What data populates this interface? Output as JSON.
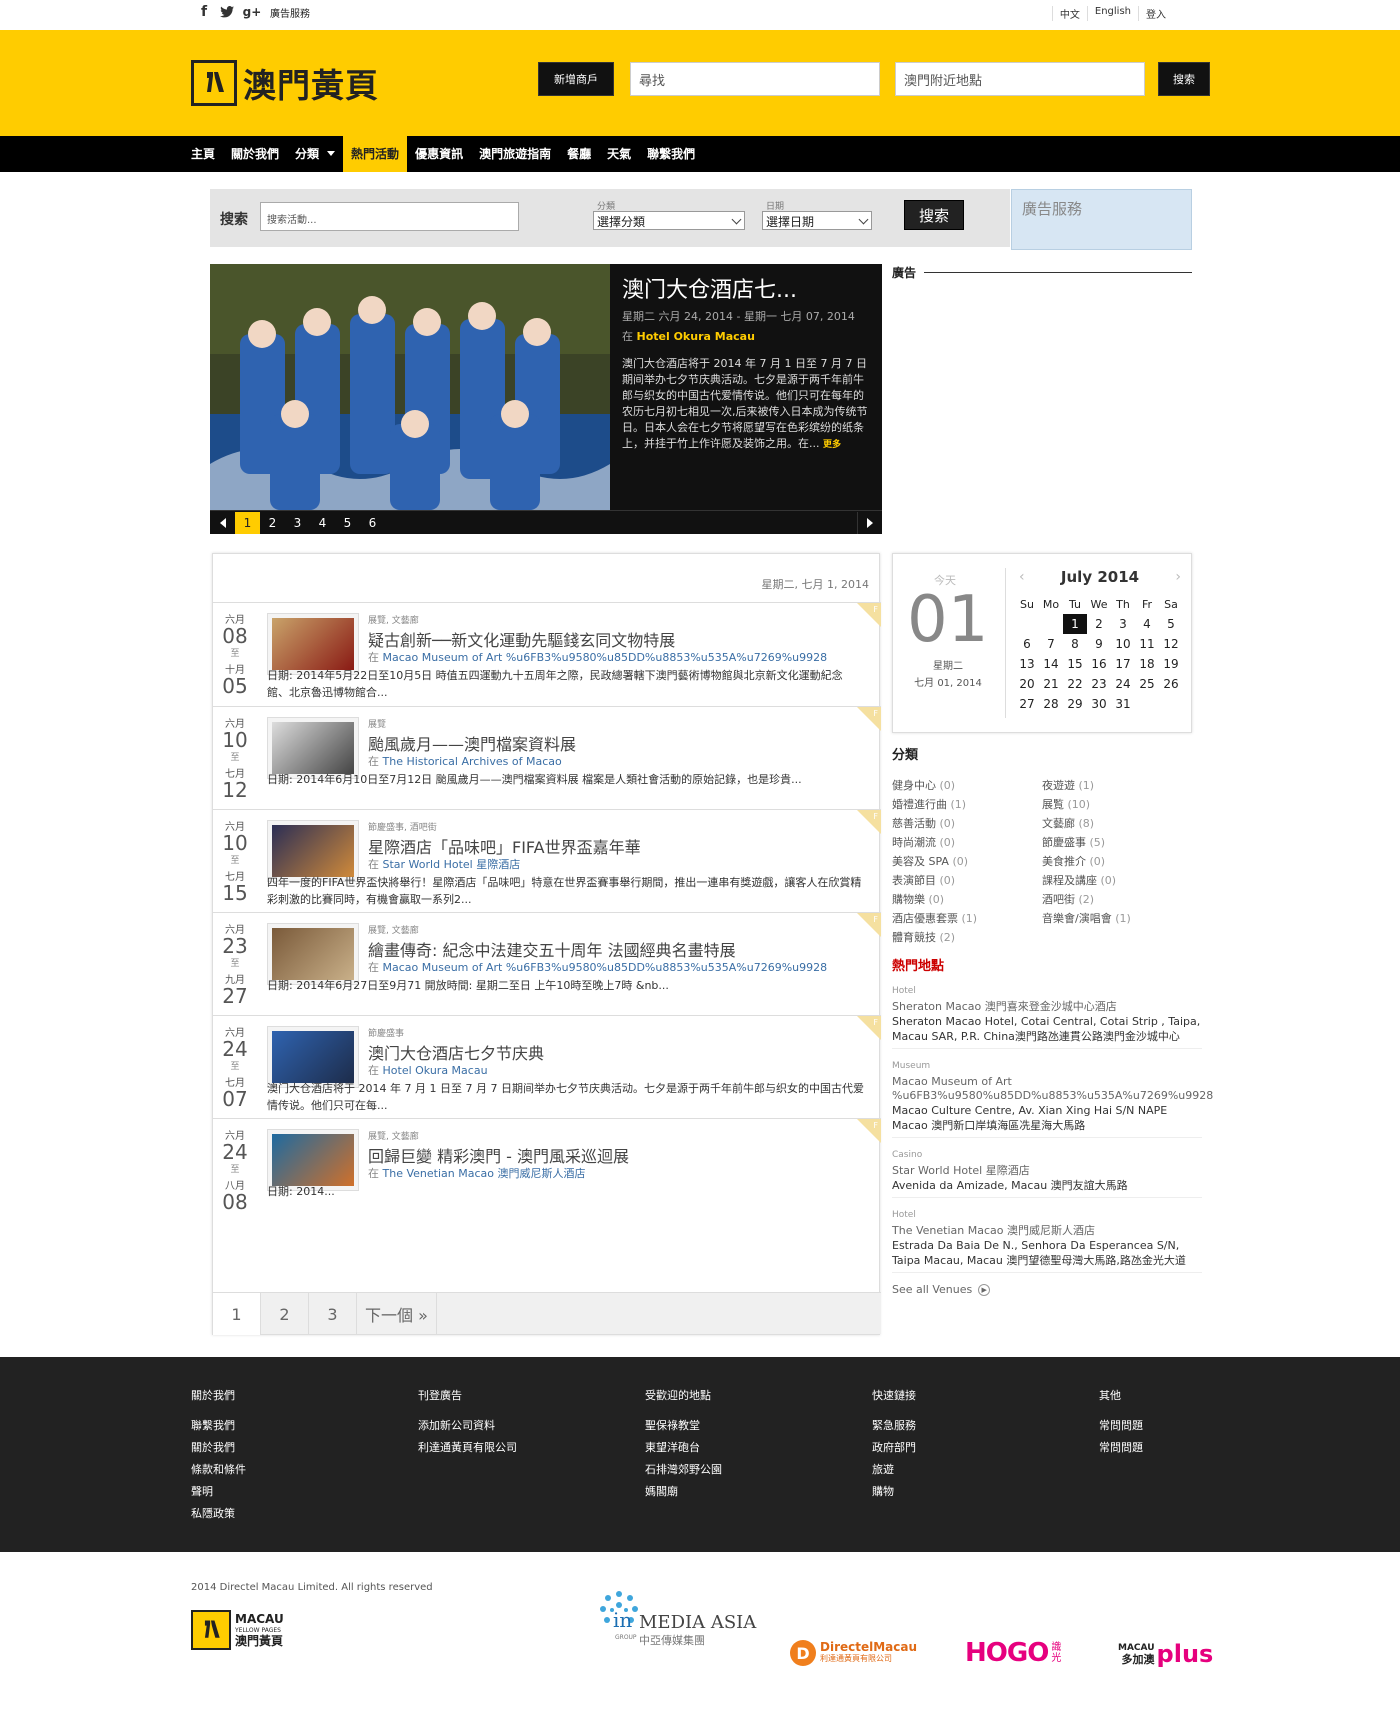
{
  "topbar": {
    "social": [
      "f",
      "t",
      "g+"
    ],
    "ad_service": "廣告服務",
    "lang": [
      "中文",
      "English",
      "登入"
    ]
  },
  "header": {
    "logo_text": "澳門黃頁",
    "add_merchant": "新增商戶",
    "search_placeholder": "尋找",
    "location_placeholder": "澳門附近地點",
    "search_button": "搜索"
  },
  "nav": [
    "主頁",
    "關於我們",
    "分類",
    "熱門活動",
    "優惠資訊",
    "澳門旅遊指南",
    "餐廳",
    "天氣",
    "聯繫我們"
  ],
  "search_bar": {
    "label": "搜索",
    "placeholder": "搜索活動...",
    "cat_label": "分類",
    "cat_value": "選擇分類",
    "date_label": "日期",
    "date_value": "選擇日期",
    "button": "搜索",
    "ad": "廣告服務"
  },
  "ads_heading": "廣告",
  "slider": {
    "title": "澳门大仓酒店七...",
    "date": "星期二 六月 24, 2014 - 星期一 七月 07, 2014",
    "at": "在",
    "venue": "Hotel Okura Macau",
    "desc": "澳门大仓酒店将于 2014 年 7 月 1 日至 7 月 7 日期间举办七夕节庆典活动。七夕是源于两千年前牛郎与织女的中国古代爱情传说。他们只可在每年的农历七月初七相见一次,后来被传入日本成为传统节日。日本人会在七夕节将愿望写在色彩缤纷的纸条上，并挂于竹上作许愿及装饰之用。在...",
    "more": "更多",
    "pages": [
      "1",
      "2",
      "3",
      "4",
      "5",
      "6"
    ]
  },
  "list": {
    "header_date": "星期二, 七月 1, 2014",
    "to": "至",
    "at": "在",
    "events": [
      {
        "m1": "六月",
        "d1": "08",
        "m2": "十月",
        "d2": "05",
        "tags": "展覽, 文藝廊",
        "title": "疑古創新──新文化運動先驅錢玄同文物特展",
        "venue": "Macao Museum of Art %u6FB3%u9580%u85DD%u8853%u535A%u7269%u9928",
        "desc": "日期: 2014年5月22日至10月5日 時值五四運動九十五周年之際，民政總署轄下澳門藝術博物館與北京新文化運動紀念 館、北京魯迅博物館合..."
      },
      {
        "m1": "六月",
        "d1": "10",
        "m2": "七月",
        "d2": "12",
        "tags": "展覽",
        "title": "颱風歲月——澳門檔案資料展",
        "venue": "The Historical Archives of Macao",
        "desc": "日期: 2014年6月10日至7月12日 颱風歲月——澳門檔案資料展 檔案是人類社會活動的原始記錄，也是珍貴..."
      },
      {
        "m1": "六月",
        "d1": "10",
        "m2": "七月",
        "d2": "15",
        "tags": "節慶盛事, 酒吧街",
        "title": "星際酒店「品味吧」FIFA世界盃嘉年華",
        "venue": "Star World Hotel 星際酒店",
        "desc": "四年一度的FIFA世界盃快將舉行！星際酒店「品味吧」特意在世界盃賽事舉行期間，推出一連串有獎遊戲，讓客人在欣賞精彩刺激的比賽同時，有機會贏取一系列2..."
      },
      {
        "m1": "六月",
        "d1": "23",
        "m2": "九月",
        "d2": "27",
        "tags": "展覽, 文藝廊",
        "title": "繪畫傳奇: 紀念中法建交五十周年 法國經典名畫特展",
        "venue": "Macao Museum of Art %u6FB3%u9580%u85DD%u8853%u535A%u7269%u9928",
        "desc": "日期: 2014年6月27日至9月71 開放時間: 星期二至日 上午10時至晚上7時       &nb..."
      },
      {
        "m1": "六月",
        "d1": "24",
        "m2": "七月",
        "d2": "07",
        "tags": "節慶盛事",
        "title": "澳门大仓酒店七夕节庆典",
        "venue": "Hotel Okura Macau",
        "desc": "澳门大仓酒店将于 2014 年 7 月 1 日至 7 月 7 日期间举办七夕节庆典活动。七夕是源于两千年前牛郎与织女的中国古代爱情传说。他们只可在每..."
      },
      {
        "m1": "六月",
        "d1": "24",
        "m2": "八月",
        "d2": "08",
        "tags": "展覽, 文藝廊",
        "title": "回歸巨變 精彩澳門 - 澳門風采巡迴展",
        "venue": "The Venetian Macao 澳門威尼斯人酒店",
        "desc": "日期:            2014..."
      }
    ],
    "flag": "F",
    "pages": [
      "1",
      "2",
      "3",
      "下一個 »"
    ]
  },
  "today": {
    "label": "今天",
    "day": "01",
    "weekday": "星期二",
    "date": "七月 01, 2014",
    "month": "July 2014",
    "dow": [
      "Su",
      "Mo",
      "Tu",
      "We",
      "Th",
      "Fr",
      "Sa"
    ],
    "weeks": [
      [
        "",
        "",
        "1",
        "2",
        "3",
        "4",
        "5"
      ],
      [
        "6",
        "7",
        "8",
        "9",
        "10",
        "11",
        "12"
      ],
      [
        "13",
        "14",
        "15",
        "16",
        "17",
        "18",
        "19"
      ],
      [
        "20",
        "21",
        "22",
        "23",
        "24",
        "25",
        "26"
      ],
      [
        "27",
        "28",
        "29",
        "30",
        "31",
        "",
        ""
      ]
    ]
  },
  "categories": {
    "heading": "分類",
    "items": [
      {
        "n": "健身中心",
        "c": "(0)"
      },
      {
        "n": "夜遊遊",
        "c": "(1)"
      },
      {
        "n": "婚禮進行曲",
        "c": "(1)"
      },
      {
        "n": "展覧",
        "c": "(10)"
      },
      {
        "n": "慈善活動",
        "c": "(0)"
      },
      {
        "n": "文藝廊",
        "c": "(8)"
      },
      {
        "n": "時尚潮流",
        "c": "(0)"
      },
      {
        "n": "節慶盛事",
        "c": "(5)"
      },
      {
        "n": "美容及 SPA",
        "c": "(0)"
      },
      {
        "n": "美食推介",
        "c": "(0)"
      },
      {
        "n": "表演節目",
        "c": "(0)"
      },
      {
        "n": "課程及講座",
        "c": "(0)"
      },
      {
        "n": "購物樂",
        "c": "(0)"
      },
      {
        "n": "酒吧街",
        "c": "(2)"
      },
      {
        "n": "酒店優惠套票",
        "c": "(1)"
      },
      {
        "n": "音樂會/演唱會",
        "c": "(1)"
      },
      {
        "n": "體育競技",
        "c": "(2)"
      },
      {
        "n": "",
        "c": ""
      }
    ]
  },
  "hot": {
    "heading": "熱門地點",
    "venues": [
      {
        "type": "Hotel",
        "name": "Sheraton Macao 澳門喜來登金沙城中心酒店",
        "addr": "Sheraton Macao Hotel, Cotai Central, Cotai Strip , Taipa, Macau SAR, P.R. China澳門路氹連貫公路澳門金沙城中心"
      },
      {
        "type": "Museum",
        "name": "Macao Museum of Art %u6FB3%u9580%u85DD%u8853%u535A%u7269%u9928",
        "addr": "Macao Culture Centre, Av. Xian Xing Hai S/N NAPE Macao 澳門新口岸填海區冼星海大馬路"
      },
      {
        "type": "Casino",
        "name": "Star World Hotel 星際酒店",
        "addr": "Avenida da Amizade, Macau 澳門友誼大馬路"
      },
      {
        "type": "Hotel",
        "name": "The Venetian Macao 澳門威尼斯人酒店",
        "addr": "Estrada Da Baia De N., Senhora Da Esperanceа S/N, Taipa Macau, Macau 澳門望德聖母灣大馬路,路氹金光大道"
      }
    ],
    "see_all": "See all Venues"
  },
  "footer": {
    "cols": [
      {
        "h": "關於我們",
        "links": [
          "聯繫我們",
          "關於我們",
          "條款和條件",
          "聲明",
          "私隱政策"
        ]
      },
      {
        "h": "刊登廣告",
        "links": [
          "添加新公司資料",
          "利達通黃頁有限公司"
        ]
      },
      {
        "h": "受歡迎的地點",
        "links": [
          "聖保祿教堂",
          "東望洋砲台",
          "石排灣郊野公園",
          "媽閣廟"
        ]
      },
      {
        "h": "快速鏈接",
        "links": [
          "緊急服務",
          "政府部門",
          "旅遊",
          "購物"
        ]
      },
      {
        "h": "其他",
        "links": [
          "常問問題",
          "常問問題"
        ]
      }
    ]
  },
  "bottom": {
    "copyright": "2014 Directel Macau Limited. All rights reserved",
    "macau_logo": "MACAU",
    "macau_sub": "YELLOW PAGES",
    "macau_cn": "澳門黃頁",
    "media_asia": "MEDIA ASIA",
    "media_in": "in",
    "media_group": "GROUP",
    "media_cn": "中亞傳媒集團",
    "directel": "DirectelMacau",
    "directel_cn": "利達通黃頁有限公司",
    "hogo": "HOGO",
    "hogo_cn": "識光",
    "plus_macau": "MACAU",
    "plus_cn": "多加澳",
    "plus": "plus"
  }
}
